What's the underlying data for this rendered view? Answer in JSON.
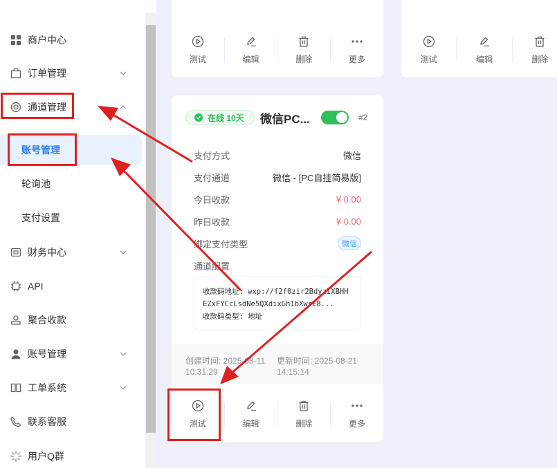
{
  "sidebar": {
    "items": [
      {
        "label": "商户中心",
        "icon": "grid-icon",
        "chevron": ""
      },
      {
        "label": "订单管理",
        "icon": "bag-icon",
        "chevron": "down"
      },
      {
        "label": "通道管理",
        "icon": "lifebuoy-icon",
        "chevron": "up"
      },
      {
        "label": "财务中心",
        "icon": "wallet-icon",
        "chevron": "down"
      },
      {
        "label": "API",
        "icon": "chip-icon",
        "chevron": ""
      },
      {
        "label": "聚合收款",
        "icon": "aggregate-icon",
        "chevron": ""
      },
      {
        "label": "账号管理",
        "icon": "user-icon",
        "chevron": "down"
      },
      {
        "label": "工单系统",
        "icon": "book-icon",
        "chevron": "down"
      },
      {
        "label": "联系客服",
        "icon": "phone-icon",
        "chevron": ""
      },
      {
        "label": "用户Q群",
        "icon": "loading-icon",
        "chevron": ""
      }
    ],
    "submenu": [
      {
        "label": "账号管理",
        "active": true
      },
      {
        "label": "轮询池",
        "active": false
      },
      {
        "label": "支付设置",
        "active": false
      }
    ]
  },
  "actions": {
    "test": "测试",
    "edit": "编辑",
    "delete": "删除",
    "more": "更多"
  },
  "card": {
    "status": "在线 10天",
    "title": "微信PC...",
    "toggle_on": true,
    "number": "#2",
    "rows": [
      {
        "key": "支付方式",
        "value": "微信"
      },
      {
        "key": "支付通道",
        "value": "微信 - [PC自挂简易版]"
      },
      {
        "key": "今日收款",
        "value": "¥ 0.00"
      },
      {
        "key": "昨日收款",
        "value": "¥ 0.00"
      },
      {
        "key": "绑定支付类型",
        "value": "微信"
      },
      {
        "key": "通道配置",
        "value": ""
      }
    ],
    "config": {
      "line1": "收款码地址: wxp://f2f0zir2BdyzIXBHH",
      "line2": "EZxFYCcLsdNe5QXdixGh1bXwrE8...",
      "line3": "收款码类型: 地址"
    },
    "created": "创建时间: 2025-08-11 10:31:29",
    "updated": "更新时间: 2025-08-21 14:15:14"
  },
  "colors": {
    "accent": "#2f80ed",
    "online_green": "#2fbf5b",
    "amount_red": "#f56c6c",
    "annotation_red": "#e02020"
  }
}
